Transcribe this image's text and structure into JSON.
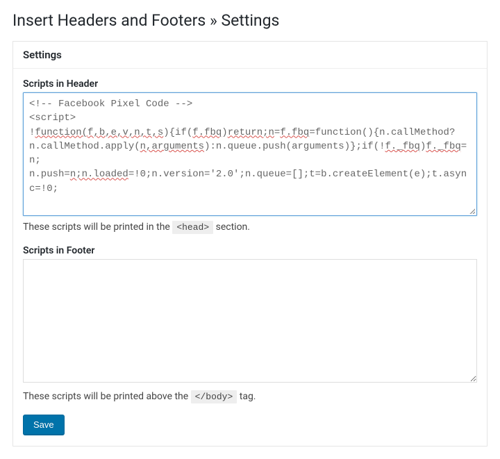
{
  "page": {
    "title": "Insert Headers and Footers » Settings"
  },
  "panel": {
    "heading": "Settings"
  },
  "header": {
    "label": "Scripts in Header",
    "help_prefix": "These scripts will be printed in the ",
    "help_code": "<head>",
    "help_suffix": " section.",
    "code_segments": [
      {
        "t": "<!-- Facebook Pixel Code -->",
        "s": false,
        "br": true
      },
      {
        "t": "<script>",
        "s": false,
        "br": true
      },
      {
        "t": "!",
        "s": false
      },
      {
        "t": "function(",
        "s": true
      },
      {
        "t": "f,b,e,v,n,t,s",
        "s": true
      },
      {
        "t": "){if(",
        "s": false
      },
      {
        "t": "f.fbq",
        "s": true
      },
      {
        "t": ")",
        "s": false
      },
      {
        "t": "return;n",
        "s": true
      },
      {
        "t": "=",
        "s": false
      },
      {
        "t": "f.fbq",
        "s": true
      },
      {
        "t": "=function(){n.callMethod?",
        "s": false,
        "br": true
      },
      {
        "t": "n.callMethod.apply(",
        "s": false
      },
      {
        "t": "n,arguments",
        "s": true
      },
      {
        "t": "):n.queue.push(arguments)};if(!",
        "s": false
      },
      {
        "t": "f._fbq",
        "s": true
      },
      {
        "t": ")",
        "s": false
      },
      {
        "t": "f._fbq",
        "s": true
      },
      {
        "t": "=n;",
        "s": false,
        "br": true
      },
      {
        "t": "n.push=",
        "s": false
      },
      {
        "t": "n;n.loaded",
        "s": true
      },
      {
        "t": "=!0;n.version='2.0';n.queue=[];t=b.createElement(e);t.async=!0;",
        "s": false
      }
    ]
  },
  "footer": {
    "label": "Scripts in Footer",
    "value": "",
    "help_prefix": "These scripts will be printed above the ",
    "help_code": "</body>",
    "help_suffix": " tag."
  },
  "actions": {
    "save_label": "Save"
  }
}
